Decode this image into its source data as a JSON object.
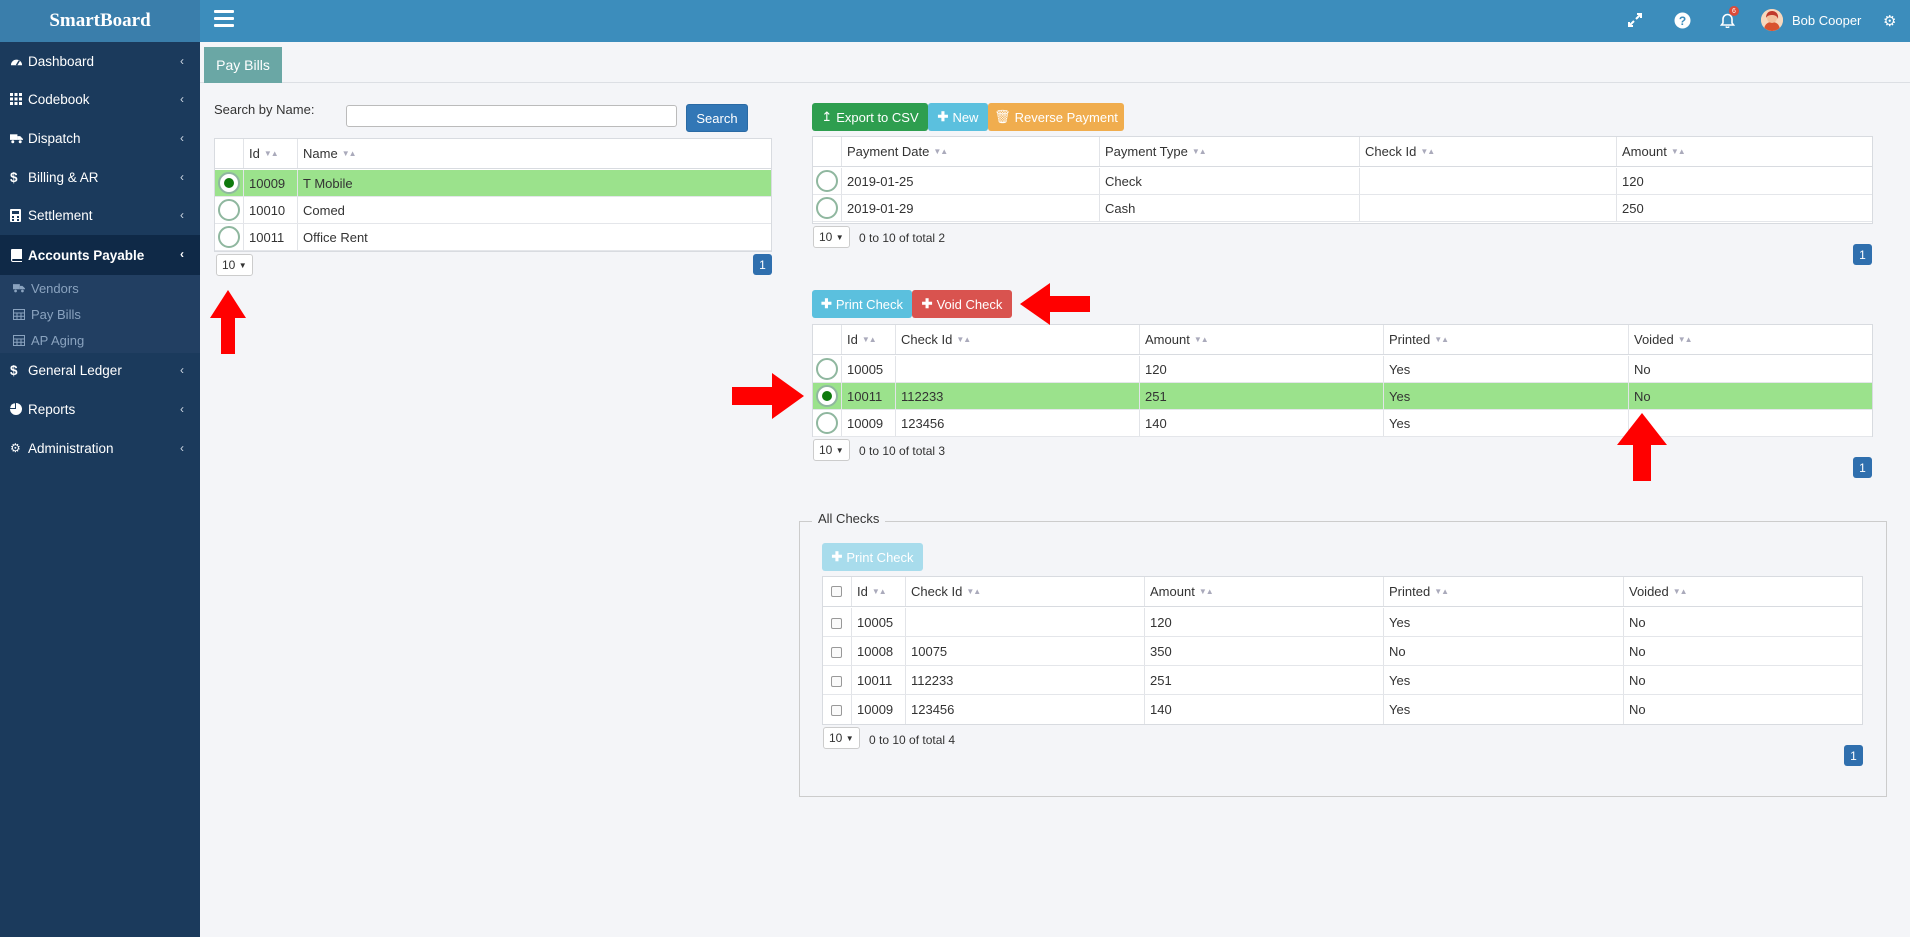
{
  "app": {
    "brand": "SmartBoard"
  },
  "topbar": {
    "notification_count": "6",
    "user_name": "Bob Cooper"
  },
  "sidebar": {
    "items": [
      {
        "label": "Dashboard",
        "icon": "dashboard-icon"
      },
      {
        "label": "Codebook",
        "icon": "grid-icon"
      },
      {
        "label": "Dispatch",
        "icon": "truck-icon"
      },
      {
        "label": "Billing & AR",
        "icon": "dollar-icon"
      },
      {
        "label": "Settlement",
        "icon": "calculator-icon"
      },
      {
        "label": "Accounts Payable",
        "icon": "book-icon"
      },
      {
        "label": "General Ledger",
        "icon": "dollar-icon"
      },
      {
        "label": "Reports",
        "icon": "pie-chart-icon"
      },
      {
        "label": "Administration",
        "icon": "cogs-icon"
      }
    ],
    "subitems": [
      {
        "label": "Vendors",
        "icon": "truck-icon"
      },
      {
        "label": "Pay Bills",
        "icon": "table-icon"
      },
      {
        "label": "AP Aging",
        "icon": "table-icon"
      }
    ]
  },
  "tabs": {
    "active": "Pay Bills"
  },
  "vendors": {
    "search_label": "Search by Name:",
    "search_value": "",
    "search_button": "Search",
    "columns": [
      "Id",
      "Name"
    ],
    "rows": [
      {
        "id": "10009",
        "name": "T Mobile",
        "selected": true
      },
      {
        "id": "10010",
        "name": "Comed",
        "selected": false
      },
      {
        "id": "10011",
        "name": "Office Rent",
        "selected": false
      }
    ],
    "page_size": "10",
    "page": "1"
  },
  "payments": {
    "buttons": {
      "export": "Export to CSV",
      "new": "New",
      "reverse": "Reverse Payment"
    },
    "columns": [
      "Payment Date",
      "Payment Type",
      "Check Id",
      "Amount"
    ],
    "rows": [
      {
        "date": "2019-01-25",
        "type": "Check",
        "check_id": "",
        "amount": "120"
      },
      {
        "date": "2019-01-29",
        "type": "Cash",
        "check_id": "",
        "amount": "250"
      }
    ],
    "page_size": "10",
    "total_text": "0 to 10 of total 2",
    "page": "1"
  },
  "checks": {
    "buttons": {
      "print": "Print Check",
      "void": "Void Check"
    },
    "columns": [
      "Id",
      "Check Id",
      "Amount",
      "Printed",
      "Voided"
    ],
    "rows": [
      {
        "id": "10005",
        "check_id": "",
        "amount": "120",
        "printed": "Yes",
        "voided": "No",
        "selected": false
      },
      {
        "id": "10011",
        "check_id": "112233",
        "amount": "251",
        "printed": "Yes",
        "voided": "No",
        "selected": true
      },
      {
        "id": "10009",
        "check_id": "123456",
        "amount": "140",
        "printed": "Yes",
        "voided": "",
        "selected": false
      }
    ],
    "page_size": "10",
    "total_text": "0 to 10 of total 3",
    "page": "1"
  },
  "all_checks": {
    "legend": "All Checks",
    "print_button": "Print Check",
    "columns": [
      "Id",
      "Check Id",
      "Amount",
      "Printed",
      "Voided"
    ],
    "rows": [
      {
        "id": "10005",
        "check_id": "",
        "amount": "120",
        "printed": "Yes",
        "voided": "No"
      },
      {
        "id": "10008",
        "check_id": "10075",
        "amount": "350",
        "printed": "No",
        "voided": "No"
      },
      {
        "id": "10011",
        "check_id": "112233",
        "amount": "251",
        "printed": "Yes",
        "voided": "No"
      },
      {
        "id": "10009",
        "check_id": "123456",
        "amount": "140",
        "printed": "Yes",
        "voided": "No"
      }
    ],
    "page_size": "10",
    "total_text": "0 to 10 of total 4",
    "page": "1"
  },
  "colors": {
    "sidebar": "#1b3a5c",
    "topbar": "#3c8dbc",
    "selected_row": "#9be28c",
    "export_button": "#2e9e4f",
    "new_button": "#5bc0de",
    "reverse_button": "#f0ad4e",
    "void_button": "#d9534f",
    "annotation_arrow": "#ff0000"
  }
}
